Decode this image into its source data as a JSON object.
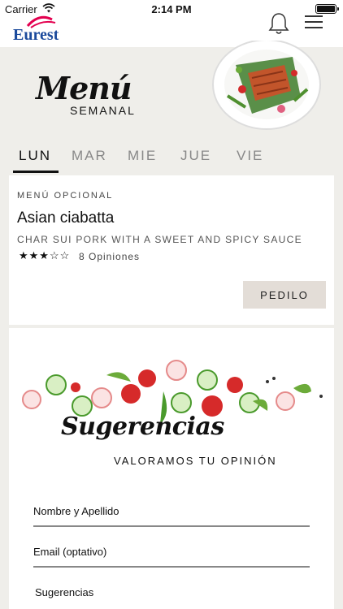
{
  "status": {
    "carrier": "Carrier",
    "time": "2:14 PM"
  },
  "nav": {
    "logo_text": "Eurest",
    "bell_icon": "bell-icon",
    "menu_icon": "hamburger-icon"
  },
  "hero": {
    "title": "Menú",
    "subtitle": "SEMANAL"
  },
  "tabs": [
    {
      "label": "LUN",
      "active": true
    },
    {
      "label": "MAR",
      "active": false
    },
    {
      "label": "MIE",
      "active": false
    },
    {
      "label": "JUE",
      "active": false
    },
    {
      "label": "VIE",
      "active": false
    }
  ],
  "dish": {
    "category": "MENÚ OPCIONAL",
    "name": "Asian ciabatta",
    "description": "CHAR SUI PORK WITH A SWEET AND SPICY SAUCE",
    "rating": 3,
    "rating_max": 5,
    "rating_text": "★★★☆☆",
    "reviews": "8 Opiniones",
    "order_button": "PEDILO"
  },
  "suggestions": {
    "title": "Sugerencias",
    "tagline": "VALORAMOS TU OPINIÓN",
    "fields": [
      {
        "label": "Nombre y Apellido"
      },
      {
        "label": "Email (optativo)"
      },
      {
        "label": "Sugerencias"
      }
    ]
  },
  "colors": {
    "accent_blue": "#1b4a9c",
    "logo_red": "#e3004f",
    "button_bg": "#e3ddd7",
    "page_bg": "#efeeea"
  }
}
